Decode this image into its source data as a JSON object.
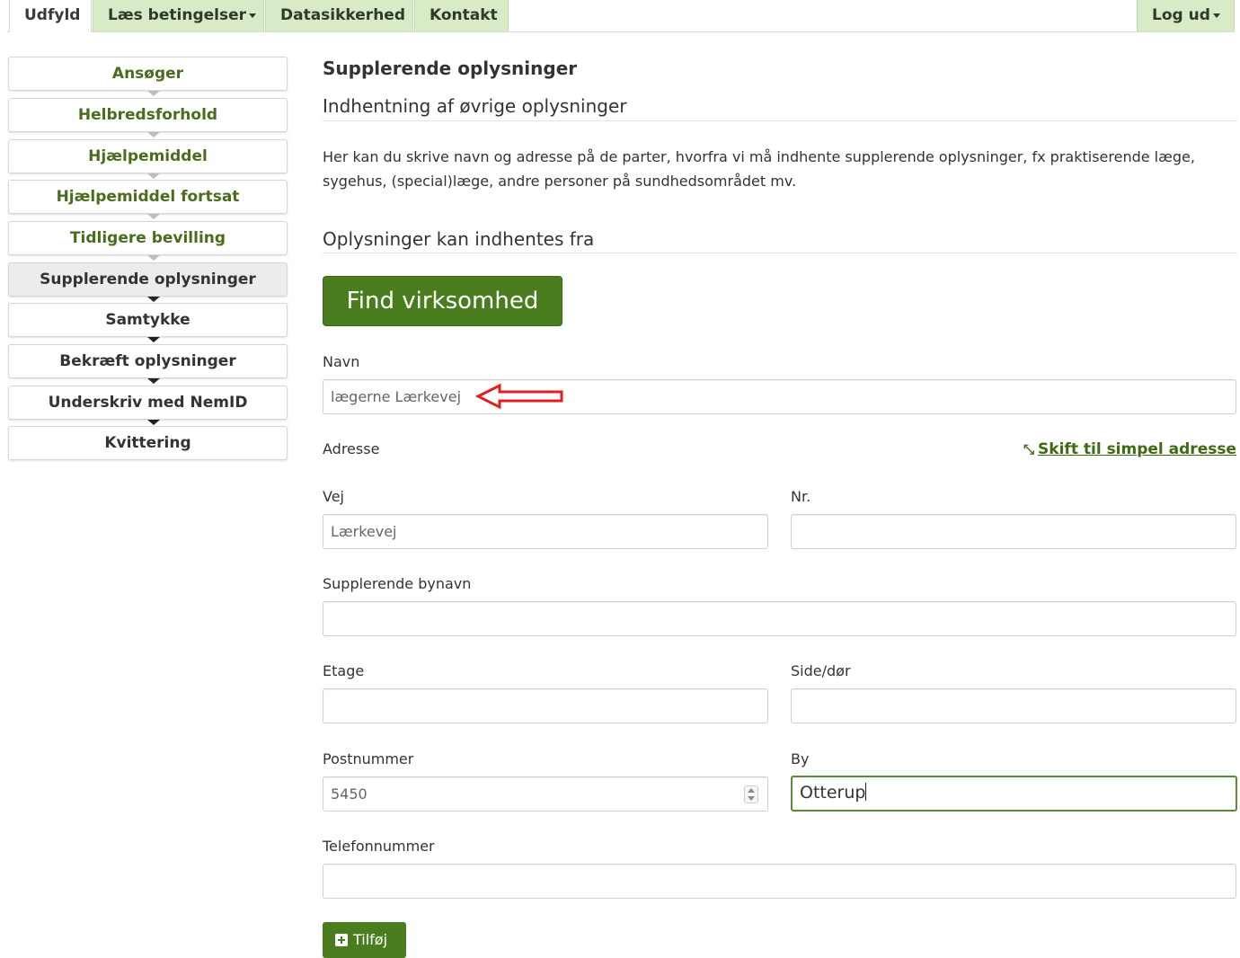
{
  "nav": {
    "tabs": [
      {
        "label": "Udfyld"
      },
      {
        "label": "Læs betingelser"
      },
      {
        "label": "Datasikkerhed"
      },
      {
        "label": "Kontakt"
      }
    ],
    "logout": "Log ud"
  },
  "steps": [
    {
      "label": "Ansøger"
    },
    {
      "label": "Helbredsforhold"
    },
    {
      "label": "Hjælpemiddel"
    },
    {
      "label": "Hjælpemiddel fortsat"
    },
    {
      "label": "Tidligere bevilling"
    },
    {
      "label": "Supplerende oplysninger"
    },
    {
      "label": "Samtykke"
    },
    {
      "label": "Bekræft oplysninger"
    },
    {
      "label": "Underskriv med NemID"
    },
    {
      "label": "Kvittering"
    }
  ],
  "main": {
    "title": "Supplerende oplysninger",
    "subtitle": "Indhentning af øvrige oplysninger",
    "description": "Her kan du skrive navn og adresse på de parter, hvorfra vi må indhente supplerende oplysninger, fx praktiserende læge, sygehus, (special)læge, andre personer på sundhedsområdet mv.",
    "section_heading": "Oplysninger kan indhentes fra",
    "find_button": "Find virksomhed",
    "simple_address_link": "Skift til simpel adresse",
    "add_button": "Tilføj"
  },
  "form": {
    "navn": {
      "label": "Navn",
      "value": "lægerne Lærkevej"
    },
    "adresse_label": "Adresse",
    "vej": {
      "label": "Vej",
      "value": "Lærkevej"
    },
    "nr": {
      "label": "Nr.",
      "value": ""
    },
    "bynavn": {
      "label": "Supplerende bynavn",
      "value": ""
    },
    "etage": {
      "label": "Etage",
      "value": ""
    },
    "side": {
      "label": "Side/dør",
      "value": ""
    },
    "postnummer": {
      "label": "Postnummer",
      "value": "5450"
    },
    "by": {
      "label": "By",
      "value": "Otterup"
    },
    "telefon": {
      "label": "Telefonnummer",
      "value": ""
    }
  },
  "colors": {
    "accent": "#4a7d1e",
    "tab_bg": "#d8ebc6",
    "annotation_arrow": "#e02020"
  }
}
